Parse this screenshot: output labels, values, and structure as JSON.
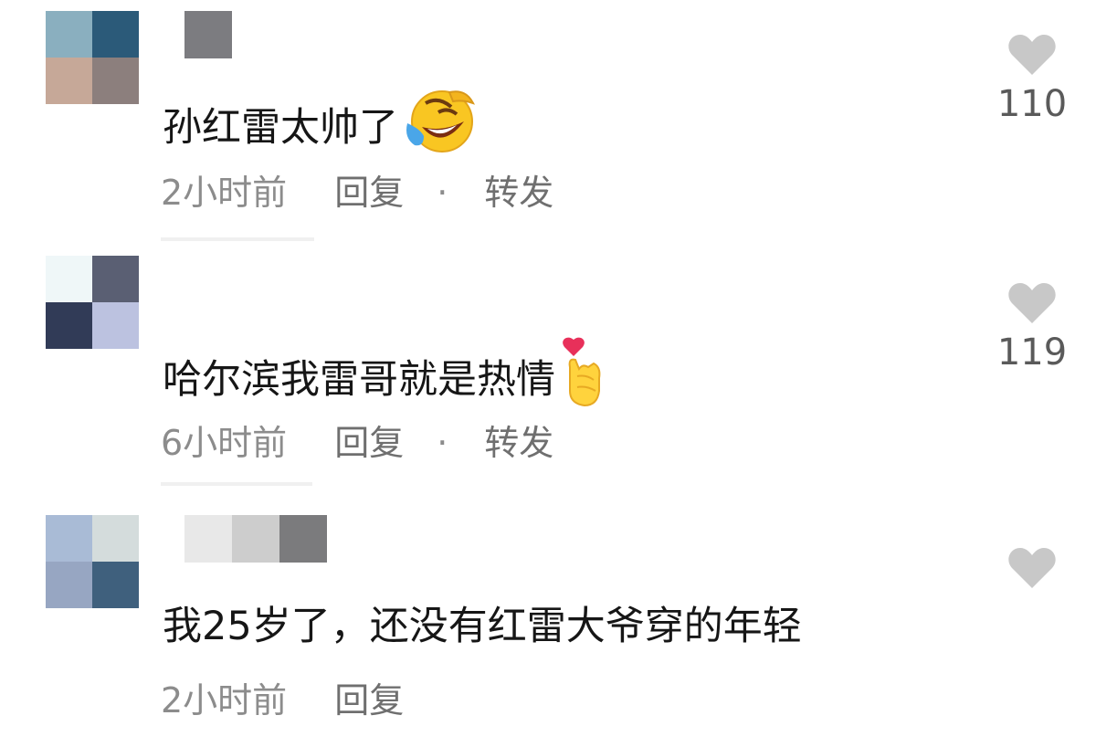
{
  "comments": [
    {
      "text": "孙红雷太帅了",
      "emoji": "rofl-emoji",
      "time": "2小时前",
      "reply": "回复",
      "dot": "·",
      "forward": "转发",
      "likes": "110",
      "avatar_colors": [
        "#8aafbf",
        "#2b5a79",
        "#c6a898",
        "#8c7f7d"
      ],
      "name_colors": [
        "#7c7c80"
      ]
    },
    {
      "text": "哈尔滨我雷哥就是热情",
      "emoji": "finger-heart-emoji",
      "time": "6小时前",
      "reply": "回复",
      "dot": "·",
      "forward": "转发",
      "likes": "119",
      "avatar_colors": [
        "#eff7f8",
        "#5a5f73",
        "#313b57",
        "#bcc2e0"
      ],
      "name_colors": []
    },
    {
      "text": "我25岁了，还没有红雷大爷穿的年轻",
      "time": "2小时前",
      "reply": "回复",
      "avatar_colors": [
        "#a9bbd6",
        "#d4dcdc",
        "#97a6c2",
        "#3f607d"
      ],
      "name_colors": [
        "#e8e8e8",
        "#cdcdcd",
        "#7b7b7d"
      ]
    }
  ],
  "colors": {
    "heart": "#c8c8c8",
    "meta_text": "#8c8c8c",
    "like_count": "#5a5a5a"
  }
}
